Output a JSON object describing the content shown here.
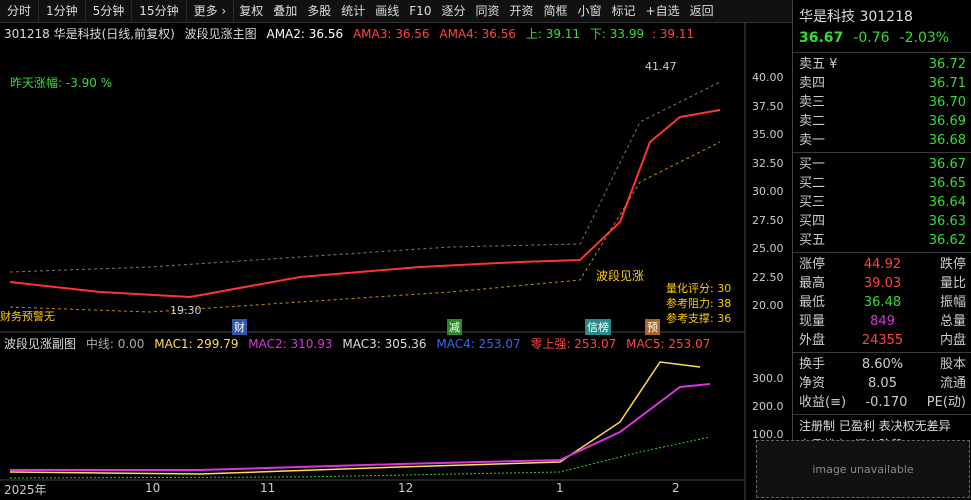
{
  "toolbar": {
    "items": [
      "分时",
      "1分钟",
      "5分钟",
      "15分钟",
      "更多 ›",
      "复权",
      "叠加",
      "多股",
      "统计",
      "画线",
      "F10",
      "逐分",
      "同资",
      "开资",
      "简框",
      "小窗",
      "标记",
      "+自选",
      "返回"
    ]
  },
  "chart": {
    "header": "301218 华是科技(日线,前复权)",
    "indicator": "波段见涨主图",
    "ama2": "AMA2: 36.56",
    "ama3": "AMA3: 36.56",
    "ama4": "AMA4: 36.56",
    "up": "上: 39.11",
    "down": "下: 33.99",
    "upper": ": 39.11",
    "prev_change": "昨天涨幅: -3.90 %",
    "high_label": "41.47",
    "low_label": "19.30",
    "signal_label": "波段见涨",
    "warning": "财务预警无",
    "score": "量化评分: 30",
    "resist": "参考阻力: 38",
    "support": "参考支撑: 36",
    "y_ticks": [
      "40.00",
      "37.50",
      "35.00",
      "32.50",
      "30.00",
      "27.50",
      "25.00",
      "22.50",
      "20.00"
    ],
    "sub_indicator": "波段见涨副图",
    "mid": "中线: 0.00",
    "mac1": "MAC1: 299.79",
    "mac2": "MAC2: 310.93",
    "mac3": "MAC3: 305.36",
    "mac4": "MAC4: 253.07",
    "zero": "零上强: 253.07",
    "mac5": "MAC5: 253.07",
    "sub_ticks": [
      "300.0",
      "200.0",
      "100.0"
    ],
    "x_ticks": [
      "2025年",
      "10",
      "11",
      "12",
      "1",
      "2"
    ],
    "tags": [
      "财",
      "减",
      "信榜",
      "预"
    ]
  },
  "panel": {
    "name": "华是科技 301218",
    "price": "36.67",
    "chg": "-0.76",
    "pct": "-2.03%",
    "asks": [
      [
        "卖五 ¥",
        "36.72"
      ],
      [
        "卖四",
        "36.71"
      ],
      [
        "卖三",
        "36.70"
      ],
      [
        "卖二",
        "36.69"
      ],
      [
        "卖一",
        "36.68"
      ]
    ],
    "bids": [
      [
        "买一",
        "36.67"
      ],
      [
        "买二",
        "36.65"
      ],
      [
        "买三",
        "36.64"
      ],
      [
        "买四",
        "36.63"
      ],
      [
        "买五",
        "36.62"
      ]
    ],
    "stats": [
      [
        "涨停",
        "44.92",
        "跌停"
      ],
      [
        "最高",
        "39.03",
        "量比"
      ],
      [
        "最低",
        "36.48",
        "振幅"
      ],
      [
        "现量",
        "849",
        "总量"
      ],
      [
        "外盘",
        "24355",
        "内盘"
      ]
    ],
    "stats2": [
      [
        "换手",
        "8.60%",
        "股本"
      ],
      [
        "净资",
        "8.05",
        "流通"
      ],
      [
        "收益(≡)",
        "-0.170",
        "PE(动)"
      ]
    ],
    "reg": "注册制 已盈利 表决权无差异",
    "trade": "交易状态: 闭市阶段 15:30:0"
  },
  "placeholder": "image unavailable"
}
